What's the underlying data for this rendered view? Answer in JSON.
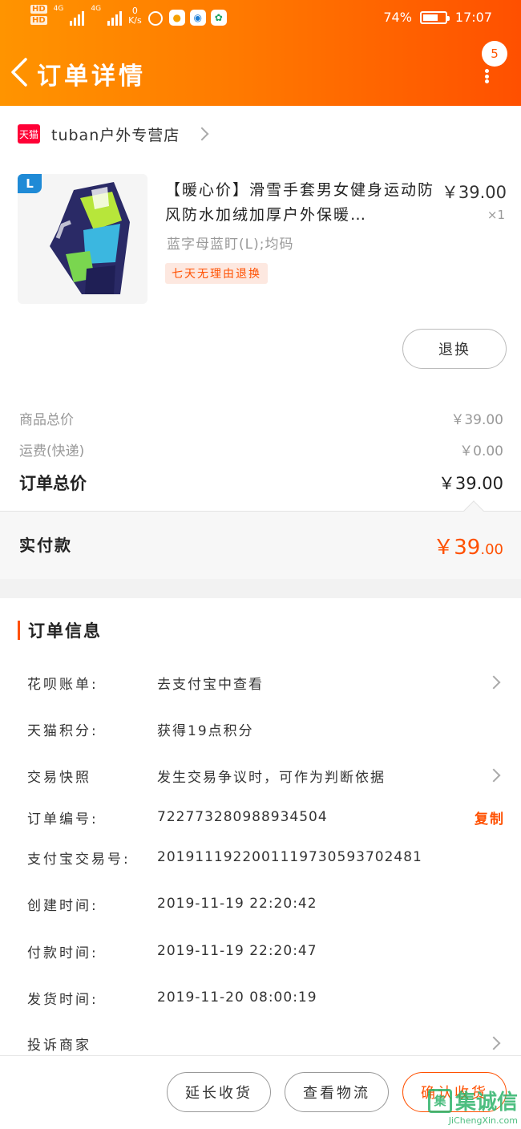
{
  "status_bar": {
    "hd1": "HD",
    "hd2": "HD",
    "net1": "4G",
    "net2": "4G",
    "speed_value": "0",
    "speed_unit": "K/s",
    "battery_percent": "74%",
    "battery_level": 0.74,
    "time": "17:07"
  },
  "nav": {
    "title": "订单详情",
    "badge": "5"
  },
  "shop": {
    "logo": "天猫",
    "name": "tuban户外专营店"
  },
  "item": {
    "size_tag": "L",
    "title": "【暖心价】滑雪手套男女健身运动防风防水加绒加厚户外保暖…",
    "price": "￥39.00",
    "qty": "×1",
    "sku": "蓝字母蓝盯(L);均码",
    "tag": "七天无理由退换",
    "return_button": "退换"
  },
  "summary": {
    "goods_label": "商品总价",
    "goods_value": "￥39.00",
    "shipping_label": "运费(快递)",
    "shipping_value": "￥0.00",
    "total_label": "订单总价",
    "total_value": "￥39.00"
  },
  "paid": {
    "label": "实付款",
    "int": "￥39",
    "dec": ".00"
  },
  "order_info": {
    "title": "订单信息",
    "rows": [
      {
        "label": "花呗账单:",
        "value": "去支付宝中查看"
      },
      {
        "label": "天猫积分:",
        "value": "获得19点积分"
      },
      {
        "label": "交易快照",
        "value": "发生交易争议时，可作为判断依据"
      },
      {
        "label": "订单编号:",
        "value": "722773280988934504",
        "action": "复制"
      },
      {
        "label": "支付宝交易号:",
        "value": "2019111922001119730593702481"
      },
      {
        "label": "创建时间:",
        "value": "2019-11-19 22:20:42"
      },
      {
        "label": "付款时间:",
        "value": "2019-11-19 22:20:47"
      },
      {
        "label": "发货时间:",
        "value": "2019-11-20 08:00:19"
      },
      {
        "label": "投诉商家",
        "value": ""
      }
    ]
  },
  "footer": {
    "extend": "延长收货",
    "logistics": "查看物流",
    "confirm": "确认收货"
  },
  "watermark": {
    "main": "集诚信",
    "sub": "JiChengXin.com"
  },
  "colors": {
    "accent": "#ff5000",
    "header_start": "#ff9400",
    "header_end": "#ff5000",
    "tmall_red": "#ff0036"
  }
}
